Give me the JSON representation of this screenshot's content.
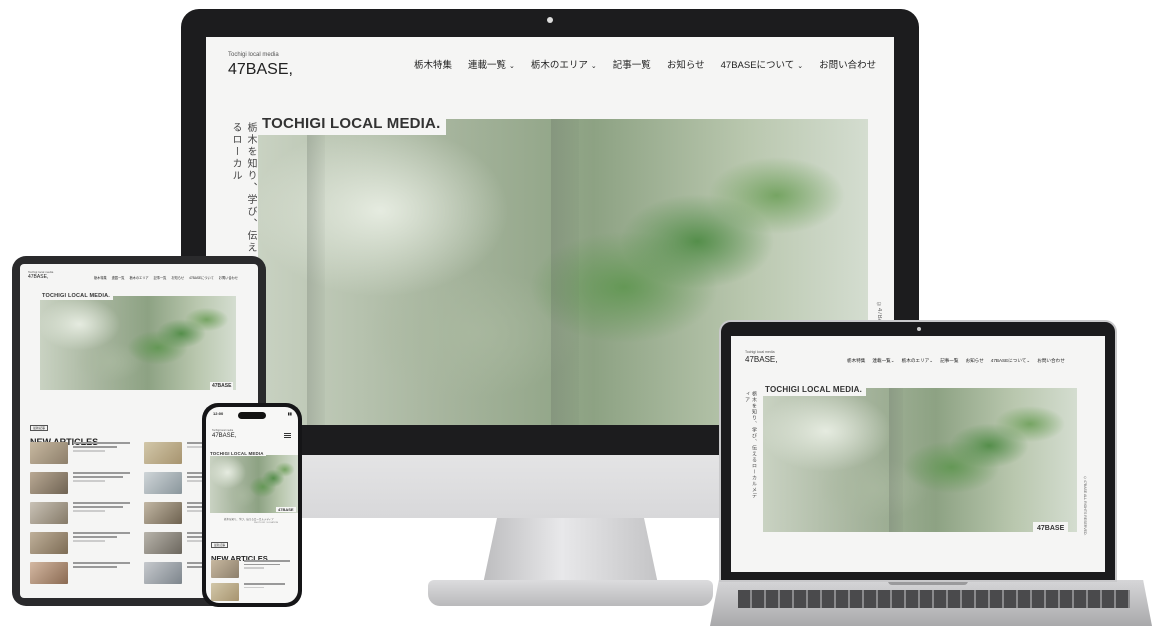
{
  "site": {
    "tagline_small": "Tochigi local media",
    "brand": "47BASE,",
    "hero_title": "TOCHIGI LOCAL MEDIA.",
    "hero_title_mobile": "TOCHIGI LOCAL MEDIA",
    "vertical_copy": "栃木を知り、学び、伝えるローカル",
    "vertical_copy_short": "栃木を知り、学び、伝えるローカルメディア",
    "copyright_vertical": "©47BASE",
    "copyright_laptop": "©47BASE ALL RIGHTS RESERVED.",
    "badge": "47BASE",
    "nav": [
      {
        "label": "栃木特集",
        "dropdown": false
      },
      {
        "label": "連載一覧",
        "dropdown": true
      },
      {
        "label": "栃木のエリア",
        "dropdown": true
      },
      {
        "label": "記事一覧",
        "dropdown": false
      },
      {
        "label": "お知らせ",
        "dropdown": false
      },
      {
        "label": "47BASEについて",
        "dropdown": true
      },
      {
        "label": "お問い合わせ",
        "dropdown": false
      }
    ]
  },
  "articles": {
    "section_tag": "最新記事",
    "title": "NEW ARTICLES",
    "phone_tagline": "栃木を知り、学び、伝えるローカルメディア",
    "phone_credit": "PHOTO BY / LOCATION",
    "phone_status": "12:00"
  },
  "icons": {
    "chevron": "chevron-down-icon",
    "menu": "hamburger-menu-icon"
  },
  "colors": {
    "screen_bg": "#f5f5f4",
    "bezel": "#1c1c1e",
    "text": "#222222"
  }
}
